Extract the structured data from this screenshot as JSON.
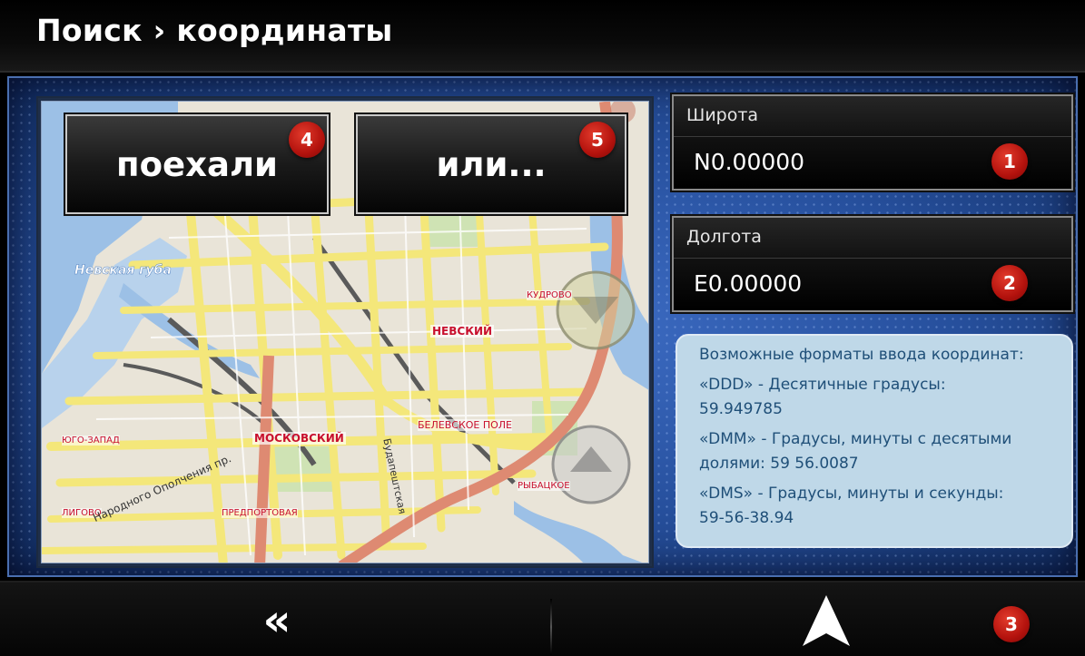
{
  "header": {
    "title": "Поиск › координаты"
  },
  "map": {
    "go_button": {
      "label": "поехали",
      "badge": "4"
    },
    "or_button": {
      "label": "или...",
      "badge": "5"
    },
    "labels": {
      "water": "Невская губа",
      "district_center": "НЕВСКИЙ",
      "kudrovo": "КУДРОВО",
      "moskovsky": "МОСКОВСКИЙ",
      "belevskoe": "БЕЛЕВСКОЕ ПОЛЕ",
      "yugo_zapad": "ЮГО-ЗАПАД",
      "rybatskoe": "РЫБАЦКОЕ",
      "ligovo": "ЛИГОВО",
      "predportovaya": "ПРЕДПОРТОВАЯ",
      "street_opolcheniya": "Народного Ополчения пр.",
      "street_budapeshtskaya": "Будапештская"
    }
  },
  "latitude": {
    "label": "Широта",
    "value": "N0.00000",
    "badge": "1"
  },
  "longitude": {
    "label": "Долгота",
    "value": "E0.00000",
    "badge": "2"
  },
  "info": {
    "title": "Возможные форматы ввода координат:",
    "ddd_label": "«DDD» - Десятичные градусы:",
    "ddd_example": "59.949785",
    "dmm_label": "«DMM» - Градусы, минуты с десятыми",
    "dmm_example": "долями: 59 56.0087",
    "dms_label": "«DMS» - Градусы, минуты и секунды:",
    "dms_example": "59-56-38.94"
  },
  "footer": {
    "back_icon": "double-chevron-left-icon",
    "navigate_icon": "navigation-arrow-icon",
    "navigate_badge": "3"
  },
  "colors": {
    "panel_blue": "#264f9c",
    "badge_red": "#c41a12",
    "info_bg": "#bfd8e8",
    "info_text": "#1f4f78",
    "road_yellow": "#f4e77a",
    "water_blue": "#9cc0e6"
  }
}
